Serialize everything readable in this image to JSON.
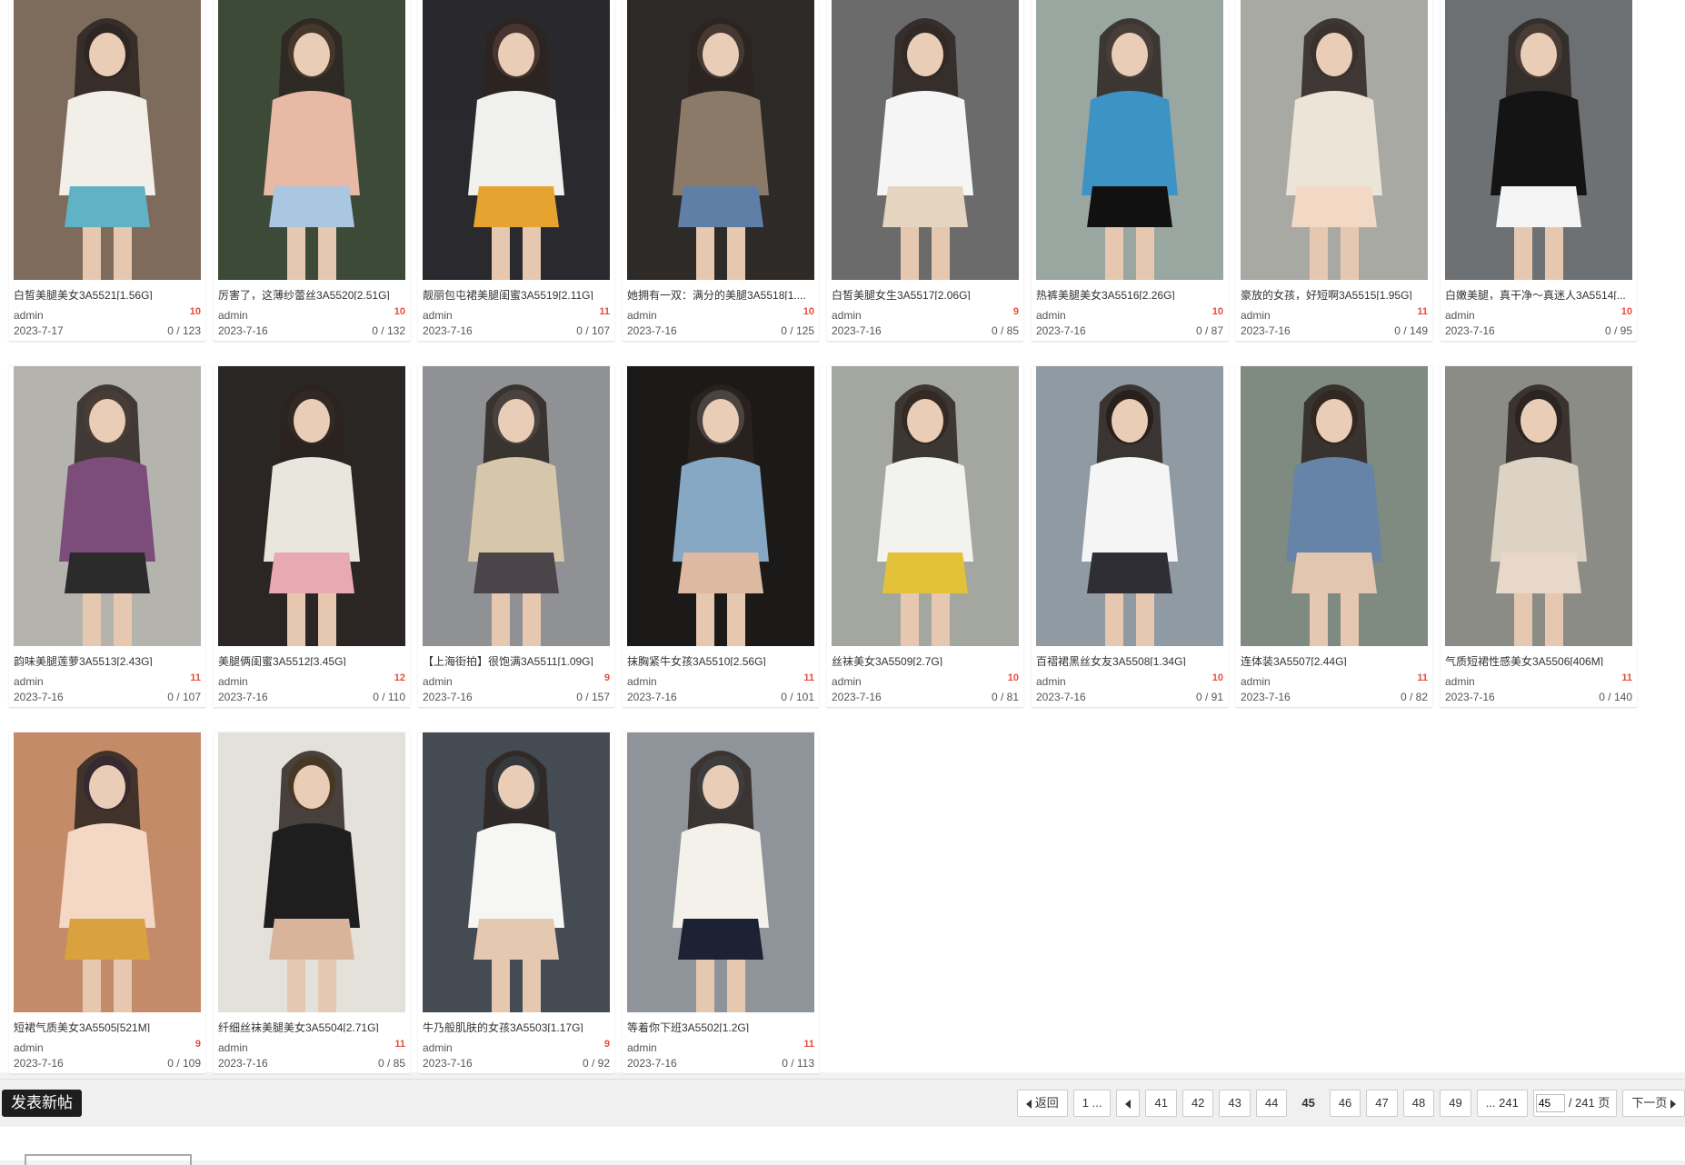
{
  "posts": [
    {
      "title": "白皙美腿美女3A5521[1.56G]",
      "author": "admin",
      "photos": "10",
      "date": "2023-7-17",
      "stats": "0 / 123",
      "icon": "photo-thumbnail",
      "colors": [
        "#7e6b5c",
        "#f2efe8",
        "#5fb3c4",
        "#3a3a3a"
      ]
    },
    {
      "title": "厉害了，这薄纱蕾丝3A5520[2.51G]",
      "author": "admin",
      "photos": "10",
      "date": "2023-7-16",
      "stats": "0 / 132",
      "icon": "photo-thumbnail",
      "colors": [
        "#3d4a38",
        "#e8b9a5",
        "#a9c7e0",
        "#d9a56a"
      ]
    },
    {
      "title": "靓丽包屯裙美腿闺蜜3A5519[2.11G]",
      "author": "admin",
      "photos": "11",
      "date": "2023-7-16",
      "stats": "0 / 107",
      "icon": "photo-thumbnail",
      "colors": [
        "#2a2a2e",
        "#f0f0ee",
        "#e7a32f",
        "#e79c9c"
      ]
    },
    {
      "title": "她拥有一双：满分的美腿3A5518[1....",
      "author": "admin",
      "photos": "10",
      "date": "2023-7-16",
      "stats": "0 / 125",
      "icon": "photo-thumbnail",
      "colors": [
        "#2d2a27",
        "#8b7a68",
        "#5f7fa6",
        "#d8b79a"
      ]
    },
    {
      "title": "白皙美腿女生3A5517[2.06G]",
      "author": "admin",
      "photos": "9",
      "date": "2023-7-16",
      "stats": "0 / 85",
      "icon": "photo-thumbnail",
      "colors": [
        "#6b6b6b",
        "#f5f5f5",
        "#e5d4c0",
        "#4a4a4a"
      ]
    },
    {
      "title": "热裤美腿美女3A5516[2.26G]",
      "author": "admin",
      "photos": "10",
      "date": "2023-7-16",
      "stats": "0 / 87",
      "icon": "photo-thumbnail",
      "colors": [
        "#9aa7a0",
        "#3e93c5",
        "#111111",
        "#e8d8c8"
      ]
    },
    {
      "title": "豪放的女孩，好短啊3A5515[1.95G]",
      "author": "admin",
      "photos": "11",
      "date": "2023-7-16",
      "stats": "0 / 149",
      "icon": "photo-thumbnail",
      "colors": [
        "#a9a9a3",
        "#ece4d6",
        "#f1d9c6",
        "#7d7d77"
      ]
    },
    {
      "title": "白嫩美腿，真干净～真迷人3A5514[...",
      "author": "admin",
      "photos": "10",
      "date": "2023-7-16",
      "stats": "0 / 95",
      "icon": "photo-thumbnail",
      "colors": [
        "#6d7173",
        "#141414",
        "#f5f5f5",
        "#e6c6ae"
      ]
    },
    {
      "title": "韵味美腿莲萝3A5513[2.43G]",
      "author": "admin",
      "photos": "11",
      "date": "2023-7-16",
      "stats": "0 / 107",
      "icon": "photo-thumbnail",
      "colors": [
        "#b5b3ae",
        "#7c4c7a",
        "#2b2b2b",
        "#e9cdb6"
      ]
    },
    {
      "title": "美腿俩闺蜜3A5512[3.45G]",
      "author": "admin",
      "photos": "12",
      "date": "2023-7-16",
      "stats": "0 / 110",
      "icon": "photo-thumbnail",
      "colors": [
        "#2b2623",
        "#e9e6dd",
        "#e8a9b2",
        "#5b4a3e"
      ]
    },
    {
      "title": "【上海街拍】很饱满3A5511[1.09G]",
      "author": "admin",
      "photos": "9",
      "date": "2023-7-16",
      "stats": "0 / 157",
      "icon": "photo-thumbnail",
      "colors": [
        "#8f9194",
        "#d6c7aa",
        "#4b4448",
        "#f4f2ef"
      ]
    },
    {
      "title": "抹胸紧牛女孩3A5510[2.56G]",
      "author": "admin",
      "photos": "11",
      "date": "2023-7-16",
      "stats": "0 / 101",
      "icon": "photo-thumbnail",
      "colors": [
        "#1c1a19",
        "#86a8c5",
        "#dcb9a0",
        "#f5f5f5"
      ]
    },
    {
      "title": "丝袜美女3A5509[2.7G]",
      "author": "admin",
      "photos": "10",
      "date": "2023-7-16",
      "stats": "0 / 81",
      "icon": "photo-thumbnail",
      "colors": [
        "#a3a7a0",
        "#f2f2ee",
        "#e3c23a",
        "#6b4f3b"
      ]
    },
    {
      "title": "百褶裙黑丝女友3A5508[1.34G]",
      "author": "admin",
      "photos": "10",
      "date": "2023-7-16",
      "stats": "0 / 91",
      "icon": "photo-thumbnail",
      "colors": [
        "#8f9aa3",
        "#f5f5f5",
        "#2e2e34",
        "#111111"
      ]
    },
    {
      "title": "连体装3A5507[2.44G]",
      "author": "admin",
      "photos": "11",
      "date": "2023-7-16",
      "stats": "0 / 82",
      "icon": "photo-thumbnail",
      "colors": [
        "#7f8a80",
        "#6684a8",
        "#e2c6af",
        "#5b3f2c"
      ]
    },
    {
      "title": "气质短裙性感美女3A5506[406M]",
      "author": "admin",
      "photos": "11",
      "date": "2023-7-16",
      "stats": "0 / 140",
      "icon": "photo-thumbnail",
      "colors": [
        "#8c8c86",
        "#ddd3c4",
        "#e8d8ca",
        "#2a2a2a"
      ]
    },
    {
      "title": "短裙气质美女3A5505[521M]",
      "author": "admin",
      "photos": "9",
      "date": "2023-7-16",
      "stats": "0 / 109",
      "icon": "photo-thumbnail",
      "colors": [
        "#c48b6a",
        "#f5d7c5",
        "#d9a23f",
        "#7b4a9c"
      ]
    },
    {
      "title": "纤细丝袜美腿美女3A5504[2.71G]",
      "author": "admin",
      "photos": "11",
      "date": "2023-7-16",
      "stats": "0 / 85",
      "icon": "photo-thumbnail",
      "colors": [
        "#e4e0da",
        "#1e1e1e",
        "#d8b59a",
        "#e2a83a"
      ]
    },
    {
      "title": "牛乃般肌肤的女孩3A5503[1.17G]",
      "author": "admin",
      "photos": "9",
      "date": "2023-7-16",
      "stats": "0 / 92",
      "icon": "photo-thumbnail",
      "colors": [
        "#454b52",
        "#f6f6f4",
        "#e5c8b2",
        "#6fb6da"
      ]
    },
    {
      "title": "等着你下班3A5502[1.2G]",
      "author": "admin",
      "photos": "11",
      "date": "2023-7-16",
      "stats": "0 / 113",
      "icon": "photo-thumbnail",
      "colors": [
        "#8e949a",
        "#f4f1ea",
        "#1c2233",
        "#a5d0e4"
      ]
    }
  ],
  "footer": {
    "new_post": "发表新帖",
    "pager": {
      "prev": "返回",
      "first": "1 ...",
      "pages": [
        "41",
        "42",
        "43",
        "44",
        "45",
        "46",
        "47",
        "48",
        "49"
      ],
      "current": "45",
      "last": "... 241",
      "jump_value": "45",
      "total": "/ 241 页",
      "next": "下一页"
    }
  },
  "colors": {
    "photo_count": "#e74c3c",
    "new_post_bg": "#1e1e1e"
  }
}
